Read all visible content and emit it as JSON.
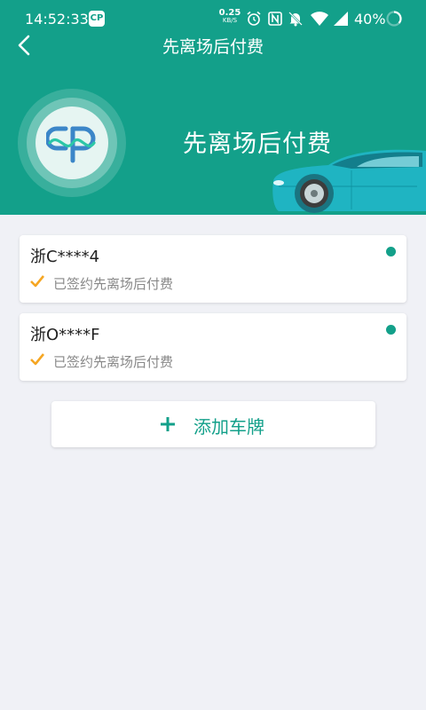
{
  "status_bar": {
    "time": "14:52:33",
    "app_icon_text": "CP",
    "net_speed_value": "0.25",
    "net_speed_unit": "KB/S",
    "battery": "40%"
  },
  "nav": {
    "title": "先离场后付费"
  },
  "banner": {
    "title": "先离场后付费"
  },
  "plates": [
    {
      "number": "浙C****4",
      "status": "已签约先离场后付费"
    },
    {
      "number": "浙O****F",
      "status": "已签约先离场后付费"
    }
  ],
  "add_button": {
    "label": "添加车牌"
  },
  "colors": {
    "primary": "#13a08a",
    "background": "#f0f1f6",
    "check": "#f5a623"
  }
}
